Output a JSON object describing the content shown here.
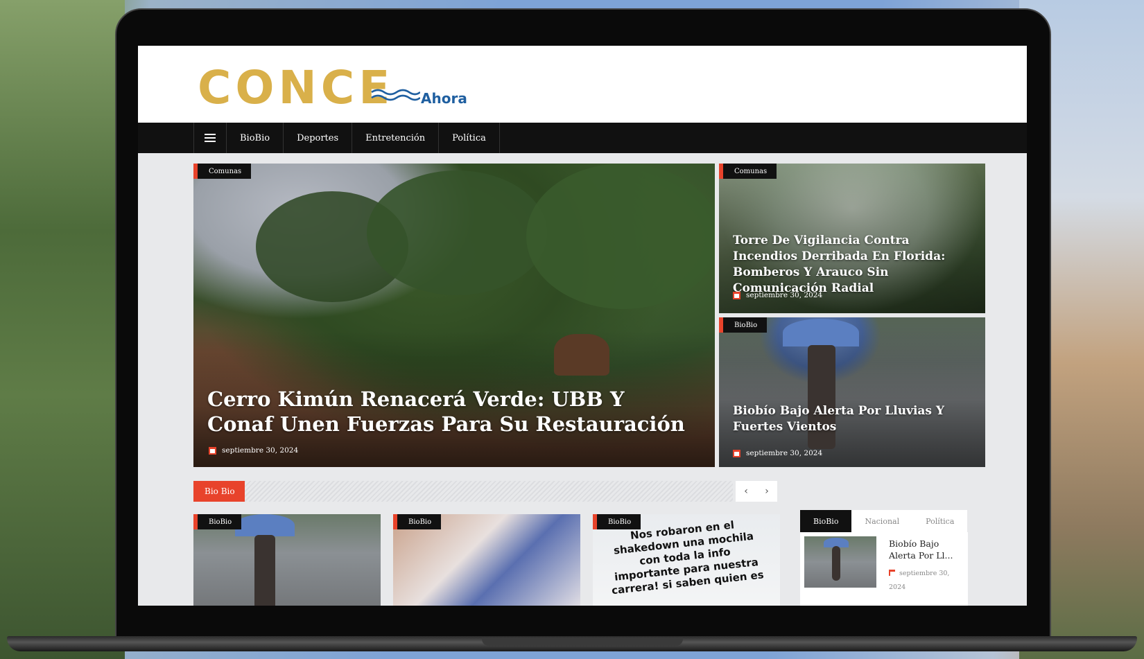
{
  "site": {
    "logo_main": "CONCE",
    "logo_sub": "Ahora"
  },
  "nav": {
    "items": [
      "BioBio",
      "Deportes",
      "Entretención",
      "Política"
    ]
  },
  "hero": {
    "main": {
      "category": "Comunas",
      "title": "Cerro Kimún Renacerá Verde: UBB Y Conaf Unen Fuerzas Para Su Restauración",
      "date": "septiembre 30, 2024"
    },
    "side1": {
      "category": "Comunas",
      "title": "Torre De Vigilancia Contra Incendios Derribada En Florida: Bomberos Y Arauco Sin Comunicación Radial",
      "date": "septiembre 30, 2024"
    },
    "side2": {
      "category": "BioBio",
      "title": "Biobío Bajo Alerta Por Lluvias Y Fuertes Vientos",
      "date": "septiembre 30, 2024"
    }
  },
  "section": {
    "label": "Bio Bio",
    "prev": "‹",
    "next": "›",
    "cards": [
      {
        "category": "BioBio"
      },
      {
        "category": "BioBio"
      },
      {
        "category": "BioBio",
        "image_text": "Nos robaron en el shakedown una mochila con toda la info importante para nuestra carrera! si saben quien es"
      }
    ]
  },
  "tabs": {
    "items": [
      "BioBio",
      "Nacional",
      "Política"
    ],
    "active": "BioBio",
    "post": {
      "title": "Biobío Bajo Alerta Por Ll...",
      "date": "septiembre 30, 2024"
    }
  },
  "colors": {
    "accent": "#e8432b",
    "logo_gold": "#d9b04a",
    "logo_blue": "#1f5fa0",
    "nav_bg": "#111111"
  }
}
